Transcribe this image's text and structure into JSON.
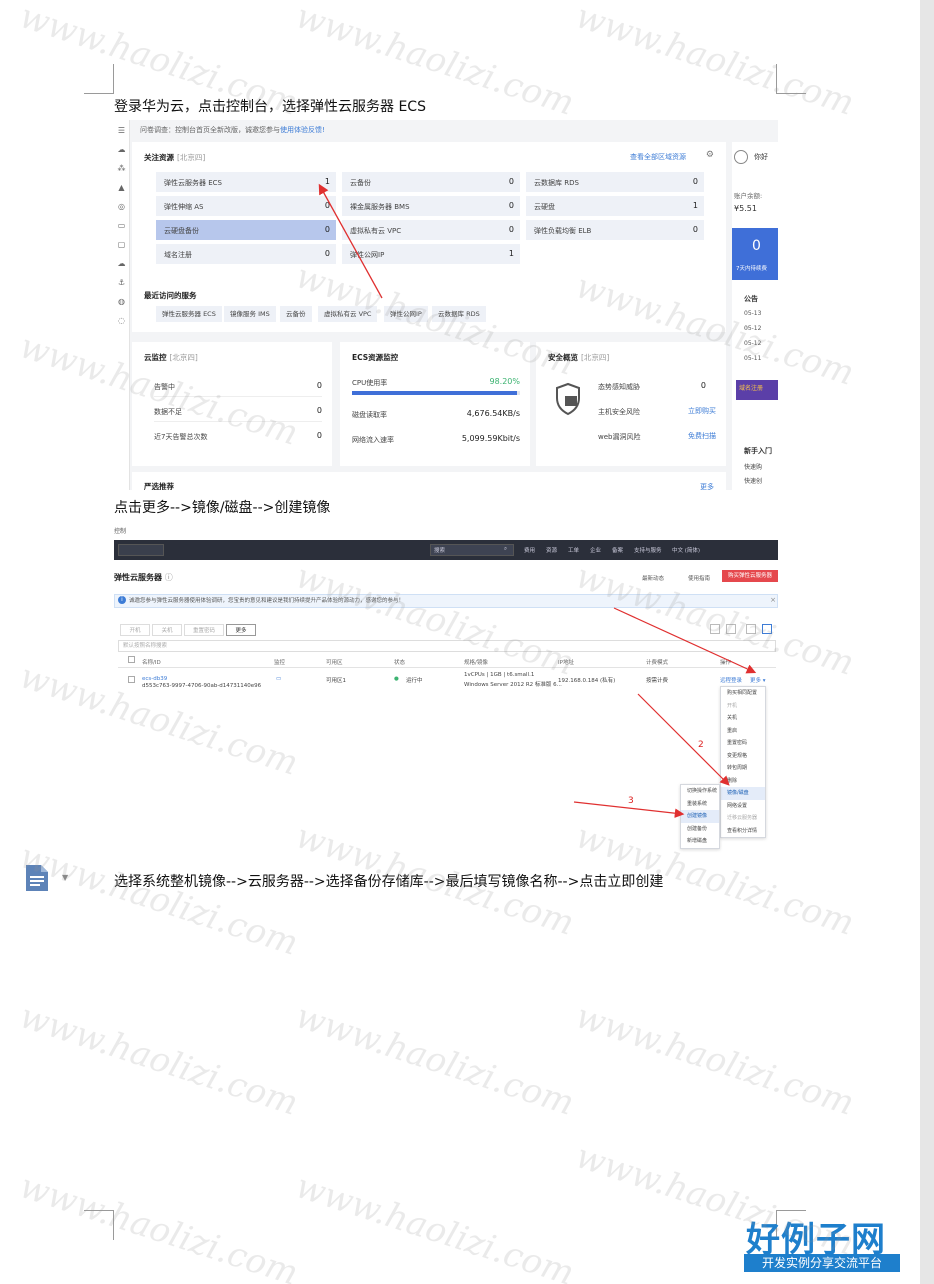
{
  "paragraphs": [
    "登录华为云，点击控制台，选择弹性云服务器 ECS",
    "点击更多-->镜像/磁盘-->创建镜像",
    "选择系统整机镜像-->云服务器-->选择备份存储库-->最后填写镜像名称-->点击立即创建"
  ],
  "watermark": "www.haolizi.com",
  "shot1": {
    "survey_text": "问卷调查：控制台首页全新改版，诚邀您参与",
    "survey_link": "使用体验反馈!",
    "focus": {
      "title": "关注资源",
      "beta": "[北京四]",
      "view_all": "查看全部区域资源",
      "tiles": [
        {
          "name": "弹性云服务器 ECS",
          "value": "1"
        },
        {
          "name": "云硬盘备份",
          "value": "0"
        },
        {
          "name": "弹性伸缩 AS",
          "value": "0"
        },
        {
          "name": "云备份",
          "value": "0"
        },
        {
          "name": "虚拟私有云 VPC",
          "value": "0"
        },
        {
          "name": "裸金属服务器 BMS",
          "value": "0"
        },
        {
          "name": "弹性公网IP",
          "value": "1"
        },
        {
          "name": "云数据库 RDS",
          "value": "0"
        },
        {
          "name": "云硬盘",
          "value": "1"
        },
        {
          "name": "弹性负载均衡 ELB",
          "value": "0"
        },
        {
          "name": "域名注册",
          "value": "0"
        }
      ]
    },
    "recent": {
      "title": "最近访问的服务",
      "items": [
        "弹性云服务器 ECS",
        "镜像服务 IMS",
        "云备份",
        "虚拟私有云 VPC",
        "弹性公网IP",
        "云数据库 RDS"
      ]
    },
    "cloud_monitor": {
      "title": "云监控",
      "beta": "[北京四]",
      "rows": [
        {
          "label": "告警中",
          "value": "0"
        },
        {
          "label": "数据不足",
          "value": "0"
        },
        {
          "label": "近7天告警总次数",
          "value": "0"
        }
      ]
    },
    "ecs_monitor": {
      "title": "ECS资源监控",
      "cpu_label": "CPU使用率",
      "cpu_value": "98.20%",
      "cpu_percent": 98.2,
      "rows": [
        {
          "label": "磁盘读取率",
          "value": "4,676.54KB/s"
        },
        {
          "label": "网络流入速率",
          "value": "5,099.59Kbit/s"
        }
      ]
    },
    "security": {
      "title": "安全概览",
      "beta": "[北京四]",
      "rows": [
        {
          "label": "态势感知威胁",
          "value": "0"
        },
        {
          "label": "主机安全风险",
          "value": "立即购买"
        },
        {
          "label": "web漏洞风险",
          "value": "免费扫描"
        }
      ]
    },
    "strict": {
      "title": "严选推荐",
      "more": "更多"
    },
    "side": {
      "name": "你好",
      "balance_label": "账户余额:",
      "balance": "¥5.51",
      "pending_count": "0",
      "pending_label": "7天内待续费",
      "notice_title": "公告",
      "notice_dates": [
        "05-13",
        "05-12",
        "05-12",
        "05-11"
      ],
      "domain_promo": "域名注册",
      "newbie_title": "新手入门",
      "newbie_items": [
        "快速购",
        "快速创"
      ]
    }
  },
  "shot2": {
    "breadcrumb": "控制",
    "topnav": [
      "搜索",
      "费用",
      "资源",
      "工单",
      "企业",
      "备案",
      "支持与服务",
      "中文 (简体)"
    ],
    "title": "弹性云服务器",
    "latest": "最新动态",
    "guide": "使用指南",
    "buy": "购买弹性云服务器",
    "notice": "诚邀您参与弹性云服务器使用体验调研，您宝贵的意见和建议是我们持续提升产品体验的源动力，感谢您的参与！",
    "toolbar": [
      "开机",
      "关机",
      "重置密码",
      "更多"
    ],
    "search_placeholder": "默认按照名称搜索",
    "columns": [
      "名称/ID",
      "监控",
      "可用区",
      "状态",
      "规格/镜像",
      "IP地址",
      "计费模式",
      "操作"
    ],
    "row": {
      "name": "ecs-db39",
      "id": "d553c763-9997-4706-90ab-d14731140e96",
      "zone": "可用区1",
      "status": "运行中",
      "spec": "1vCPUs | 1GB | t6.small.1",
      "image": "Windows Server 2012 R2 标准版 6...",
      "ip": "192.168.0.184 (私有)",
      "billing": "按需计费",
      "remote": "远程登录",
      "more": "更多"
    },
    "more_menu": [
      "购买相同配置",
      "开机",
      "关机",
      "重启",
      "重置密码",
      "变更规格",
      "转包周期",
      "删除",
      "镜像/磁盘",
      "网络设置",
      "迁移云服务器",
      "查看积分详情"
    ],
    "sub_menu": [
      "切换操作系统",
      "重装系统",
      "创建镜像",
      "创建备份",
      "新增磁盘"
    ],
    "markers": [
      "2",
      "3"
    ]
  },
  "logo": {
    "big": "好例子网",
    "small": "开发实例分享交流平台"
  }
}
